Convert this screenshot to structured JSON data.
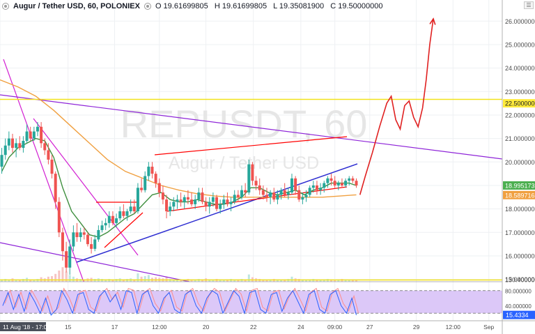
{
  "header": {
    "symbol_title": "Augur / Tether USD, 60, POLONIEX",
    "open": "O 19.61699805",
    "high": "H 19.61699805",
    "low": "L 19.35081900",
    "close": "C 19.50000000",
    "menu_icon": "hamburger-icon"
  },
  "watermark": {
    "ticker": "REPUSDT, 60",
    "name": "Augur / Tether USD"
  },
  "colors": {
    "up_candle": "#26a69a",
    "down_candle": "#ef5350",
    "ma_short": "#4caf50",
    "ma_long": "#f0a040",
    "channel": "#ff0000",
    "trendline": "#2e2ed1",
    "downtrend": "#d21fd2",
    "resistance": "#ffeb3b",
    "projection": "#e02020",
    "stoch_fill": "#dcc8f8"
  },
  "chart_data": {
    "type": "candlestick",
    "title": "Augur / Tether USD, 60, POLONIEX",
    "price_axis": {
      "ticks": [
        "26.00000000",
        "25.00000000",
        "24.00000000",
        "23.00000000",
        "22.00000000",
        "21.00000000",
        "20.00000000",
        "19.00000000",
        "18.00000000",
        "17.00000000",
        "16.00000000",
        "15.00000000",
        "130.4000000"
      ],
      "range": [
        14.9,
        26.9
      ]
    },
    "price_labels": [
      {
        "label": "22.50000000",
        "price": 22.5,
        "bg": "#ffeb3b",
        "fg": "#131722"
      },
      {
        "label": "18.99517328",
        "price": 19.0,
        "bg": "#4caf50",
        "fg": "#ffffff"
      },
      {
        "label": "18.58971636",
        "price": 18.59,
        "bg": "#f0a040",
        "fg": "#ffffff"
      }
    ],
    "time_axis": {
      "labels": [
        {
          "text": "11 Aug '18 - 17:00",
          "pos": 0,
          "highlight": true
        },
        {
          "text": "15",
          "pos": 7.6
        },
        {
          "text": "17",
          "pos": 12.8
        },
        {
          "text": "12:00",
          "pos": 17.8
        },
        {
          "text": "20",
          "pos": 23.0
        },
        {
          "text": "22",
          "pos": 28.3
        },
        {
          "text": "24",
          "pos": 33.6
        },
        {
          "text": "09:00",
          "pos": 37.4
        },
        {
          "text": "27",
          "pos": 41.3
        },
        {
          "text": "29",
          "pos": 46.5
        },
        {
          "text": "12:00",
          "pos": 50.6
        },
        {
          "text": "Sep",
          "pos": 54.6
        }
      ],
      "range": [
        0,
        56.1
      ]
    },
    "candles": [
      [
        0.2,
        19.8,
        20.6,
        19.5,
        20.3
      ],
      [
        0.6,
        20.3,
        21.0,
        20.1,
        20.7
      ],
      [
        1.0,
        20.7,
        21.3,
        20.5,
        21.0
      ],
      [
        1.4,
        21.0,
        21.2,
        20.4,
        20.6
      ],
      [
        1.8,
        20.6,
        21.0,
        20.2,
        20.8
      ],
      [
        2.2,
        20.8,
        21.1,
        20.5,
        20.6
      ],
      [
        2.6,
        20.6,
        21.1,
        20.4,
        20.9
      ],
      [
        3.0,
        20.9,
        21.6,
        20.8,
        21.3
      ],
      [
        3.4,
        21.3,
        21.5,
        20.9,
        21.0
      ],
      [
        3.8,
        21.0,
        21.5,
        20.9,
        21.3
      ],
      [
        4.2,
        21.3,
        21.7,
        21.1,
        21.5
      ],
      [
        4.6,
        21.5,
        21.7,
        20.6,
        20.8
      ],
      [
        5.0,
        20.8,
        21.0,
        20.3,
        20.5
      ],
      [
        5.4,
        20.5,
        20.8,
        19.9,
        20.1
      ],
      [
        5.8,
        20.1,
        20.3,
        19.3,
        19.5
      ],
      [
        6.2,
        19.5,
        19.6,
        18.0,
        18.3
      ],
      [
        6.6,
        18.3,
        18.5,
        16.8,
        17.0
      ],
      [
        7.0,
        17.0,
        17.2,
        15.8,
        16.2
      ],
      [
        7.4,
        16.2,
        16.6,
        15.3,
        15.5
      ],
      [
        7.8,
        15.5,
        16.7,
        15.2,
        16.4
      ],
      [
        8.2,
        16.4,
        17.3,
        16.2,
        17.0
      ],
      [
        8.6,
        17.0,
        17.4,
        16.6,
        16.8
      ],
      [
        9.0,
        16.8,
        17.2,
        16.6,
        17.0
      ],
      [
        9.4,
        17.0,
        17.2,
        16.7,
        16.9
      ],
      [
        9.8,
        16.9,
        17.0,
        16.4,
        16.5
      ],
      [
        10.2,
        16.5,
        16.8,
        16.1,
        16.3
      ],
      [
        10.6,
        16.3,
        16.9,
        16.2,
        16.7
      ],
      [
        11.0,
        16.7,
        17.3,
        16.6,
        17.1
      ],
      [
        11.4,
        17.1,
        17.5,
        17.0,
        17.3
      ],
      [
        11.8,
        17.3,
        17.6,
        17.1,
        17.4
      ],
      [
        12.2,
        17.4,
        17.9,
        17.2,
        17.7
      ],
      [
        12.6,
        17.7,
        17.9,
        17.3,
        17.4
      ],
      [
        13.0,
        17.4,
        17.8,
        17.2,
        17.6
      ],
      [
        13.4,
        17.6,
        18.1,
        17.5,
        17.9
      ],
      [
        13.8,
        17.9,
        18.2,
        17.6,
        17.7
      ],
      [
        14.2,
        17.7,
        18.0,
        17.5,
        17.9
      ],
      [
        14.6,
        17.9,
        18.4,
        17.8,
        18.1
      ],
      [
        15.0,
        18.1,
        18.4,
        17.8,
        17.9
      ],
      [
        15.4,
        17.9,
        19.1,
        17.8,
        18.9
      ],
      [
        15.8,
        18.9,
        19.3,
        18.7,
        18.8
      ],
      [
        16.2,
        18.8,
        19.6,
        18.7,
        19.4
      ],
      [
        16.6,
        19.4,
        20.0,
        19.2,
        19.8
      ],
      [
        17.0,
        19.8,
        20.0,
        19.3,
        19.5
      ],
      [
        17.4,
        19.5,
        19.6,
        18.9,
        19.1
      ],
      [
        17.8,
        19.1,
        19.3,
        18.5,
        18.7
      ],
      [
        18.2,
        18.7,
        19.0,
        18.2,
        18.4
      ],
      [
        18.6,
        18.4,
        18.6,
        17.6,
        17.9
      ],
      [
        19.0,
        17.9,
        18.3,
        17.7,
        18.1
      ],
      [
        19.4,
        18.1,
        18.5,
        17.9,
        18.3
      ],
      [
        19.8,
        18.3,
        18.6,
        18.0,
        18.4
      ],
      [
        20.2,
        18.4,
        18.7,
        18.1,
        18.3
      ],
      [
        20.6,
        18.3,
        18.6,
        18.0,
        18.5
      ],
      [
        21.0,
        18.5,
        18.8,
        18.2,
        18.4
      ],
      [
        21.4,
        18.4,
        18.7,
        18.1,
        18.2
      ],
      [
        21.8,
        18.2,
        18.6,
        18.0,
        18.4
      ],
      [
        22.2,
        18.4,
        18.9,
        18.3,
        18.7
      ],
      [
        22.6,
        18.7,
        18.9,
        18.2,
        18.3
      ],
      [
        23.0,
        18.3,
        18.5,
        17.9,
        18.1
      ],
      [
        23.4,
        18.1,
        18.5,
        17.8,
        18.3
      ],
      [
        23.8,
        18.3,
        18.7,
        18.1,
        18.5
      ],
      [
        24.2,
        18.5,
        18.6,
        17.9,
        18.0
      ],
      [
        24.6,
        18.0,
        18.4,
        17.8,
        18.2
      ],
      [
        25.0,
        18.2,
        18.6,
        18.0,
        18.4
      ],
      [
        25.4,
        18.4,
        18.7,
        18.1,
        18.2
      ],
      [
        25.8,
        18.2,
        18.5,
        17.9,
        18.3
      ],
      [
        26.2,
        18.3,
        18.8,
        18.2,
        18.6
      ],
      [
        26.6,
        18.6,
        18.8,
        18.3,
        18.5
      ],
      [
        27.0,
        18.5,
        19.0,
        18.4,
        18.8
      ],
      [
        27.4,
        18.8,
        19.1,
        18.5,
        18.7
      ],
      [
        27.8,
        18.7,
        20.1,
        18.6,
        19.9
      ],
      [
        28.2,
        19.9,
        20.0,
        19.0,
        19.2
      ],
      [
        28.6,
        19.2,
        19.4,
        18.8,
        19.0
      ],
      [
        29.0,
        19.0,
        19.3,
        18.6,
        18.8
      ],
      [
        29.4,
        18.8,
        19.0,
        18.4,
        18.6
      ],
      [
        29.8,
        18.6,
        18.9,
        18.3,
        18.5
      ],
      [
        30.2,
        18.5,
        18.8,
        18.2,
        18.7
      ],
      [
        30.6,
        18.7,
        18.9,
        18.3,
        18.4
      ],
      [
        31.0,
        18.4,
        18.8,
        18.2,
        18.6
      ],
      [
        31.4,
        18.6,
        18.9,
        18.4,
        18.8
      ],
      [
        31.8,
        18.8,
        19.1,
        18.5,
        18.6
      ],
      [
        32.2,
        18.6,
        18.9,
        18.4,
        18.7
      ],
      [
        32.6,
        18.7,
        19.5,
        18.6,
        19.3
      ],
      [
        33.0,
        19.3,
        19.4,
        18.6,
        18.8
      ],
      [
        33.4,
        18.8,
        19.0,
        18.3,
        18.4
      ],
      [
        33.8,
        18.4,
        18.7,
        18.2,
        18.5
      ],
      [
        34.2,
        18.5,
        18.8,
        18.3,
        18.6
      ],
      [
        34.6,
        18.6,
        19.0,
        18.5,
        18.9
      ],
      [
        35.0,
        18.9,
        19.2,
        18.7,
        19.0
      ],
      [
        35.4,
        19.0,
        19.2,
        18.6,
        18.8
      ],
      [
        35.8,
        18.8,
        19.1,
        18.6,
        18.9
      ],
      [
        36.2,
        18.9,
        19.2,
        18.7,
        19.1
      ],
      [
        36.6,
        19.1,
        19.4,
        18.9,
        19.3
      ],
      [
        37.0,
        19.3,
        19.5,
        19.0,
        19.2
      ],
      [
        37.4,
        19.2,
        19.4,
        18.9,
        19.0
      ],
      [
        37.8,
        19.0,
        19.2,
        18.8,
        19.1
      ],
      [
        38.2,
        19.1,
        19.3,
        18.9,
        19.0
      ],
      [
        38.6,
        19.0,
        19.3,
        18.9,
        19.2
      ],
      [
        39.0,
        19.2,
        19.4,
        19.0,
        19.3
      ],
      [
        39.4,
        19.3,
        19.4,
        19.1,
        19.2
      ],
      [
        39.8,
        19.2,
        19.3,
        18.9,
        19.0
      ]
    ],
    "volume": [
      0.4,
      0.5,
      0.3,
      0.6,
      0.4,
      0.3,
      0.5,
      0.7,
      0.4,
      0.3,
      0.5,
      0.8,
      0.6,
      0.9,
      1.0,
      1.4,
      2.0,
      2.6,
      1.8,
      1.2,
      0.9,
      0.6,
      0.5,
      0.4,
      0.6,
      0.7,
      0.5,
      0.6,
      0.5,
      0.4,
      0.5,
      0.4,
      0.5,
      0.6,
      0.4,
      0.5,
      0.6,
      0.4,
      1.5,
      0.9,
      1.0,
      1.2,
      0.7,
      0.8,
      0.7,
      0.6,
      0.9,
      0.5,
      0.4,
      0.5,
      0.4,
      0.3,
      0.5,
      0.4,
      0.3,
      0.5,
      0.4,
      0.6,
      0.4,
      0.3,
      0.5,
      0.4,
      0.3,
      0.4,
      0.5,
      0.3,
      0.4,
      0.5,
      0.4,
      1.3,
      0.8,
      0.6,
      0.5,
      0.4,
      0.3,
      0.4,
      0.5,
      0.4,
      0.3,
      0.4,
      0.5,
      0.9,
      0.6,
      0.5,
      0.4,
      0.3,
      0.4,
      0.5,
      0.4,
      0.3,
      0.4,
      0.5,
      0.4,
      0.3,
      0.4,
      0.5,
      0.4,
      0.3,
      0.4,
      0.3
    ],
    "ma_short": [
      [
        0.2,
        19.6
      ],
      [
        1.0,
        20.2
      ],
      [
        2.0,
        20.6
      ],
      [
        3.0,
        20.8
      ],
      [
        4.0,
        21.0
      ],
      [
        5.0,
        20.9
      ],
      [
        6.0,
        20.2
      ],
      [
        7.0,
        18.9
      ],
      [
        8.0,
        17.9
      ],
      [
        9.0,
        17.4
      ],
      [
        10.0,
        16.9
      ],
      [
        11.0,
        16.8
      ],
      [
        12.0,
        17.0
      ],
      [
        13.0,
        17.3
      ],
      [
        14.0,
        17.6
      ],
      [
        15.0,
        17.8
      ],
      [
        16.0,
        18.2
      ],
      [
        17.0,
        18.6
      ],
      [
        18.0,
        18.7
      ],
      [
        19.0,
        18.4
      ],
      [
        20.0,
        18.3
      ],
      [
        21.0,
        18.3
      ],
      [
        22.0,
        18.4
      ],
      [
        23.0,
        18.3
      ],
      [
        24.0,
        18.2
      ],
      [
        25.0,
        18.2
      ],
      [
        26.0,
        18.3
      ],
      [
        27.0,
        18.5
      ],
      [
        28.0,
        18.9
      ],
      [
        29.0,
        18.9
      ],
      [
        30.0,
        18.7
      ],
      [
        31.0,
        18.6
      ],
      [
        32.0,
        18.7
      ],
      [
        33.0,
        18.8
      ],
      [
        34.0,
        18.6
      ],
      [
        35.0,
        18.8
      ],
      [
        36.0,
        18.9
      ],
      [
        37.0,
        19.1
      ],
      [
        38.0,
        19.1
      ],
      [
        39.0,
        19.1
      ],
      [
        39.8,
        19.0
      ]
    ],
    "ma_long": [
      [
        0.0,
        23.5
      ],
      [
        2.0,
        23.2
      ],
      [
        4.0,
        22.8
      ],
      [
        6.0,
        22.2
      ],
      [
        8.0,
        21.5
      ],
      [
        10.0,
        20.8
      ],
      [
        12.0,
        20.1
      ],
      [
        14.0,
        19.6
      ],
      [
        16.0,
        19.3
      ],
      [
        18.0,
        19.0
      ],
      [
        20.0,
        18.8
      ],
      [
        22.0,
        18.65
      ],
      [
        24.0,
        18.55
      ],
      [
        26.0,
        18.5
      ],
      [
        28.0,
        18.5
      ],
      [
        30.0,
        18.5
      ],
      [
        32.0,
        18.5
      ],
      [
        34.0,
        18.5
      ],
      [
        36.0,
        18.5
      ],
      [
        38.0,
        18.55
      ],
      [
        39.8,
        18.6
      ]
    ],
    "stochastic": {
      "upper": 80,
      "lower": 20,
      "ticks": [
        "80.000000",
        "40.000000"
      ],
      "last_label": "15.4334",
      "k": [
        [
          0.3,
          40
        ],
        [
          0.9,
          75
        ],
        [
          1.5,
          30
        ],
        [
          2.1,
          70
        ],
        [
          2.7,
          25
        ],
        [
          3.3,
          75
        ],
        [
          3.9,
          50
        ],
        [
          4.5,
          20
        ],
        [
          5.1,
          60
        ],
        [
          5.7,
          15
        ],
        [
          6.3,
          30
        ],
        [
          6.9,
          80
        ],
        [
          7.5,
          55
        ],
        [
          8.1,
          20
        ],
        [
          8.7,
          70
        ],
        [
          9.3,
          75
        ],
        [
          9.9,
          30
        ],
        [
          10.5,
          20
        ],
        [
          11.1,
          65
        ],
        [
          11.7,
          80
        ],
        [
          12.3,
          50
        ],
        [
          12.9,
          70
        ],
        [
          13.5,
          30
        ],
        [
          14.1,
          80
        ],
        [
          14.7,
          75
        ],
        [
          15.3,
          20
        ],
        [
          15.9,
          70
        ],
        [
          16.5,
          80
        ],
        [
          17.1,
          40
        ],
        [
          17.7,
          20
        ],
        [
          18.3,
          60
        ],
        [
          18.9,
          75
        ],
        [
          19.5,
          30
        ],
        [
          20.1,
          20
        ],
        [
          20.7,
          70
        ],
        [
          21.3,
          80
        ],
        [
          21.9,
          40
        ],
        [
          22.5,
          20
        ],
        [
          23.1,
          60
        ],
        [
          23.7,
          80
        ],
        [
          24.3,
          70
        ],
        [
          24.9,
          20
        ],
        [
          25.5,
          50
        ],
        [
          26.1,
          80
        ],
        [
          26.7,
          65
        ],
        [
          27.3,
          20
        ],
        [
          27.9,
          75
        ],
        [
          28.5,
          80
        ],
        [
          29.1,
          30
        ],
        [
          29.7,
          20
        ],
        [
          30.3,
          70
        ],
        [
          30.9,
          75
        ],
        [
          31.5,
          25
        ],
        [
          32.1,
          60
        ],
        [
          32.7,
          80
        ],
        [
          33.3,
          50
        ],
        [
          33.9,
          20
        ],
        [
          34.5,
          70
        ],
        [
          35.1,
          80
        ],
        [
          35.7,
          30
        ],
        [
          36.3,
          20
        ],
        [
          36.9,
          70
        ],
        [
          37.5,
          80
        ],
        [
          38.1,
          40
        ],
        [
          38.7,
          20
        ],
        [
          39.3,
          60
        ],
        [
          39.8,
          15
        ]
      ]
    },
    "drawings": {
      "projection_arrow": [
        [
          40.2,
          18.6
        ],
        [
          40.8,
          19.4
        ],
        [
          41.6,
          20.4
        ],
        [
          42.4,
          21.5
        ],
        [
          43.2,
          22.5
        ],
        [
          43.7,
          22.8
        ],
        [
          44.2,
          21.8
        ],
        [
          44.7,
          21.4
        ],
        [
          45.2,
          22.4
        ],
        [
          45.7,
          22.6
        ],
        [
          46.2,
          21.9
        ],
        [
          46.7,
          21.5
        ],
        [
          47.2,
          22.3
        ],
        [
          47.6,
          23.5
        ],
        [
          48.0,
          25.0
        ],
        [
          48.4,
          26.1
        ]
      ],
      "resistance_level": 22.5
    }
  }
}
